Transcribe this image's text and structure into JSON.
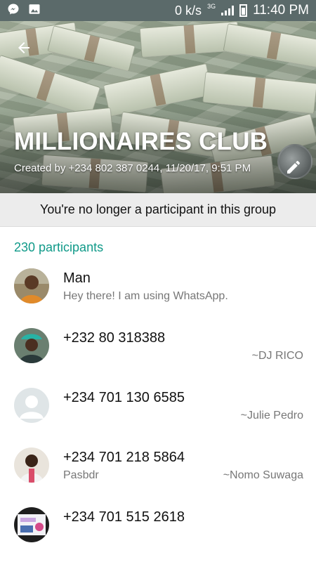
{
  "status_bar": {
    "speed": "0 k/s",
    "network": "3G",
    "time": "11:40 PM",
    "left_icons": [
      "messenger-icon",
      "gallery-icon"
    ]
  },
  "header": {
    "title": "MILLIONAIRES CLUB",
    "created_text": "Created by +234 802 387 0244, 11/20/17, 9:51 PM",
    "back_icon": "back-arrow-icon",
    "edit_icon": "pencil-icon"
  },
  "notice": {
    "text": "You're no longer a participant in this group"
  },
  "participants": {
    "count_label": "230 participants",
    "items": [
      {
        "name": "Man",
        "status": "Hey there! I am using WhatsApp.",
        "tag": "",
        "avatar": "photo"
      },
      {
        "name": "+232 80 318388",
        "status": "",
        "tag": "~DJ RICO",
        "avatar": "photo"
      },
      {
        "name": "+234 701 130 6585",
        "status": "",
        "tag": "~Julie Pedro",
        "avatar": "default"
      },
      {
        "name": "+234 701 218 5864",
        "status": "Pasbdr",
        "tag": "~Nomo Suwaga",
        "avatar": "photo"
      },
      {
        "name": "+234 701 515 2618",
        "status": "",
        "tag": "",
        "avatar": "photo"
      }
    ]
  },
  "colors": {
    "accent": "#109a89",
    "status_bar": "#5b6a6a",
    "notice_bg": "#ececec"
  }
}
